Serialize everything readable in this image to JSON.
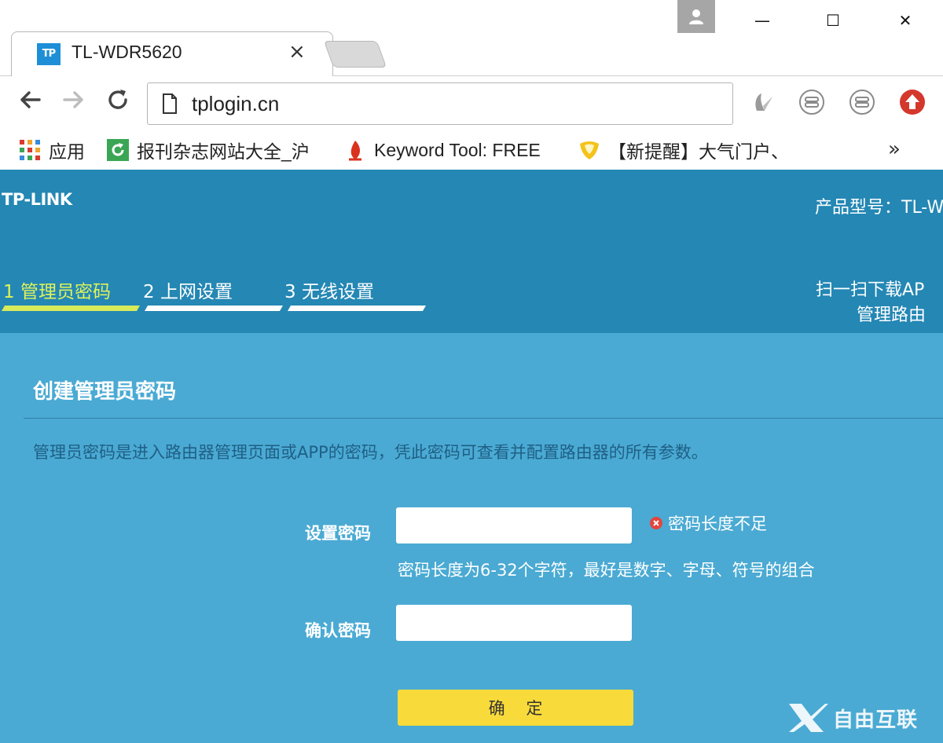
{
  "browser": {
    "tab_title": "TL-WDR5620",
    "tab_favicon_text": "TP",
    "tab_close": "×",
    "url": "tplogin.cn",
    "window_minimize": "—",
    "window_maximize": "☐",
    "window_close": "✕",
    "bookmarks": [
      {
        "label": "应用",
        "icon": "apps-grid-icon"
      },
      {
        "label": "报刊杂志网站大全_沪",
        "icon": "green-refresh-icon"
      },
      {
        "label": "Keyword Tool: FREE",
        "icon": "red-flame-icon"
      },
      {
        "label": "【新提醒】大气门户、",
        "icon": "yellow-shield-icon"
      }
    ],
    "bookmarks_more": "»"
  },
  "router": {
    "logo": "TP-LINK",
    "model_label": "产品型号：TL-W",
    "scan_line1": "扫一扫下载AP",
    "scan_line2": "管理路由",
    "steps": [
      {
        "label": "1 管理员密码",
        "active": true
      },
      {
        "label": "2 上网设置",
        "active": false
      },
      {
        "label": "3 无线设置",
        "active": false
      }
    ],
    "section_title": "创建管理员密码",
    "description": "管理员密码是进入路由器管理页面或APP的密码，凭此密码可查看并配置路由器的所有参数。",
    "password_label": "设置密码",
    "password_value": "",
    "error_text": "密码长度不足",
    "hint_text": "密码长度为6-32个字符，最好是数字、字母、符号的组合",
    "confirm_label": "确认密码",
    "confirm_value": "",
    "ok_button": "确 定"
  },
  "watermark": "自由互联",
  "colors": {
    "header_bg": "#2487b4",
    "content_bg": "#4aaad3",
    "active_step": "#d6ea5a",
    "ok_button": "#f8da3a",
    "error_icon": "#e2453c"
  }
}
